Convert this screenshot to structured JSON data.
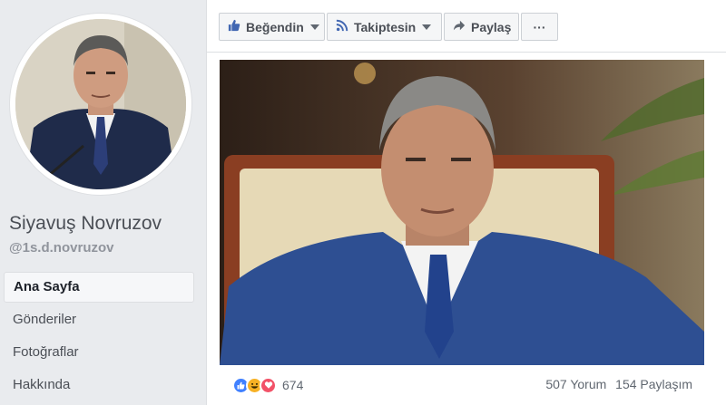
{
  "profile": {
    "name": "Siyavuş Novruzov",
    "handle": "@1s.d.novruzov"
  },
  "nav": {
    "items": [
      {
        "label": "Ana Sayfa",
        "active": true
      },
      {
        "label": "Gönderiler",
        "active": false
      },
      {
        "label": "Fotoğraflar",
        "active": false
      },
      {
        "label": "Hakkında",
        "active": false
      }
    ]
  },
  "actions": {
    "like_label": "Beğendin",
    "follow_label": "Takiptesin",
    "share_label": "Paylaş",
    "more_label": "···"
  },
  "post": {
    "reaction_count": "674",
    "comments": "507 Yorum",
    "shares": "154 Paylaşım"
  },
  "colors": {
    "brand": "#4267b2",
    "like": "#4080ff",
    "haha": "#f7b125",
    "love": "#f25268"
  },
  "icons": {
    "like": "thumbs-up-icon",
    "follow": "rss-icon",
    "share": "share-arrow-icon",
    "more": "ellipsis-icon"
  }
}
